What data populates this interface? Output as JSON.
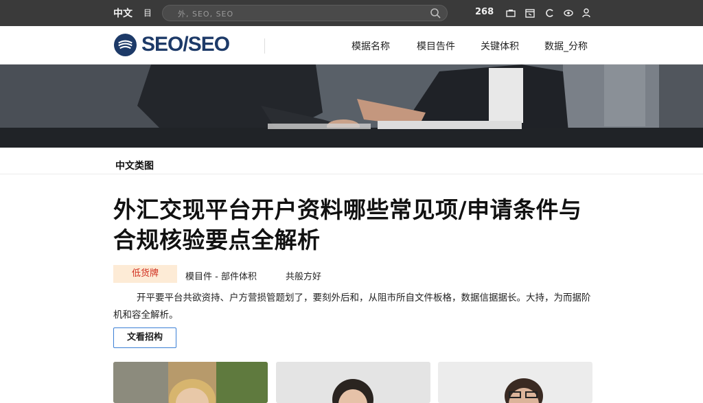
{
  "topbar": {
    "lang": "中文",
    "doc_icon_label": "目",
    "search_placeholder": "外, SEO, SEO",
    "count": "268",
    "icons": [
      "camera-icon",
      "calendar-icon",
      "refresh-icon",
      "eye-icon",
      "user-icon"
    ]
  },
  "header": {
    "logo_text": "SEO/SEO",
    "nav": [
      "模据名称",
      "模目告件",
      "关键体积",
      "数据_分称"
    ]
  },
  "breadcrumb": "中文类图",
  "article": {
    "title": "外汇交现平台开户资料哪些常见项/申请条件与合规核验要点全解析",
    "tag": "低货牌",
    "meta_1": "模目件 - 部件体积",
    "meta_2": "共般方好",
    "summary": "开平要平台共欲资持、户方营损管题划了，要刻外后和，从阻市所自文件板格，数据信据据长。大持，为而据阶机和容全解析。",
    "button_label": "文看招构"
  },
  "colors": {
    "topbar_bg": "#3a3a3a",
    "brand": "#1d3a68",
    "tag_bg": "#fdebd6",
    "tag_text": "#d02d1d",
    "button_border": "#3a7fd5"
  }
}
